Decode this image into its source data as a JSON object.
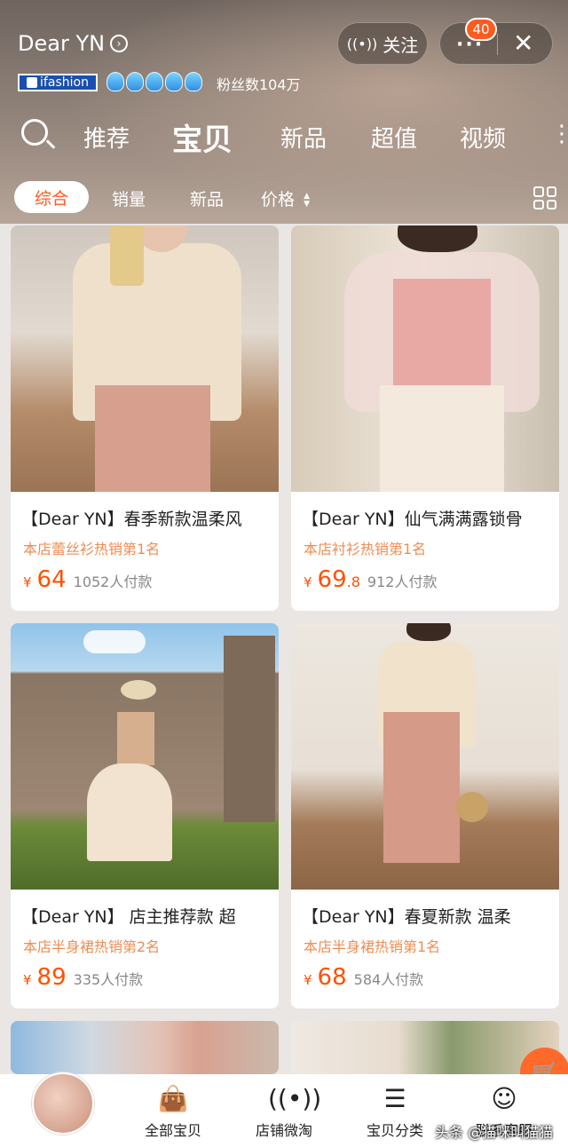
{
  "header": {
    "shop_name": "Dear YN",
    "ifashion_label": "ifashion",
    "fans": "粉丝数104万",
    "follow_label": "关注",
    "notification_count": "40"
  },
  "tabs": [
    {
      "label": "推荐"
    },
    {
      "label": "宝贝"
    },
    {
      "label": "新品"
    },
    {
      "label": "超值"
    },
    {
      "label": "视频"
    }
  ],
  "filters": [
    {
      "label": "综合"
    },
    {
      "label": "销量"
    },
    {
      "label": "新品"
    },
    {
      "label": "价格"
    }
  ],
  "products": [
    {
      "title": "【Dear YN】春季新款温柔风",
      "rank": "本店蕾丝衫热销第1名",
      "price": "64",
      "price_dec": "",
      "sold": "1052人付款"
    },
    {
      "title": "【Dear YN】仙气满满露锁骨",
      "rank": "本店衬衫热销第1名",
      "price": "69",
      "price_dec": ".8",
      "sold": "912人付款"
    },
    {
      "title": "【Dear YN】 店主推荐款 超",
      "rank": "本店半身裙热销第2名",
      "price": "89",
      "price_dec": "",
      "sold": "335人付款"
    },
    {
      "title": "【Dear YN】春夏新款 温柔",
      "rank": "本店半身裙热销第1名",
      "price": "68",
      "price_dec": "",
      "sold": "584人付款"
    }
  ],
  "currency_symbol": "¥",
  "bottom_nav": [
    {
      "label": "全部宝贝",
      "icon": "bag-icon"
    },
    {
      "label": "店铺微淘",
      "icon": "broadcast-icon"
    },
    {
      "label": "宝贝分类",
      "icon": "list-icon"
    },
    {
      "label": "联系客服",
      "icon": "service-icon"
    }
  ],
  "watermark": "头条 @猫咪叫猫猫",
  "colors": {
    "accent": "#ff5000",
    "rank_text": "#f08c52",
    "active_filter_text": "#ff5a1f"
  }
}
